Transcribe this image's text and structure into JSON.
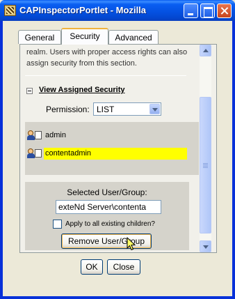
{
  "window": {
    "title": "CAPInspectorPortlet - Mozilla"
  },
  "tabs": [
    {
      "label": "General",
      "active": false
    },
    {
      "label": "Security",
      "active": true
    },
    {
      "label": "Advanced",
      "active": false
    }
  ],
  "security": {
    "description": "realm. Users with proper access rights can also assign security from this section.",
    "section_title": "View Assigned Security",
    "permission_label": "Permission:",
    "permission_value": "LIST",
    "users": [
      {
        "name": "admin",
        "selected": false
      },
      {
        "name": "contentadmin",
        "selected": true
      }
    ],
    "selected_label": "Selected User/Group:",
    "selected_value": "exteNd Server\\contenta",
    "apply_label": "Apply to all existing children?",
    "apply_checked": false,
    "remove_label": "Remove User/Group"
  },
  "footer": {
    "ok_label": "OK",
    "close_label": "Close"
  },
  "colors": {
    "titlebar": "#0a5ff2",
    "selection_highlight": "#ffff00",
    "active_tab_accent": "#f0b33c"
  },
  "icons": [
    "app-icon",
    "minimize-icon",
    "maximize-icon",
    "close-icon",
    "collapse-icon",
    "user-group-icon",
    "dropdown-arrow-icon",
    "scroll-up-icon",
    "scroll-down-icon",
    "mouse-pointer-icon"
  ]
}
